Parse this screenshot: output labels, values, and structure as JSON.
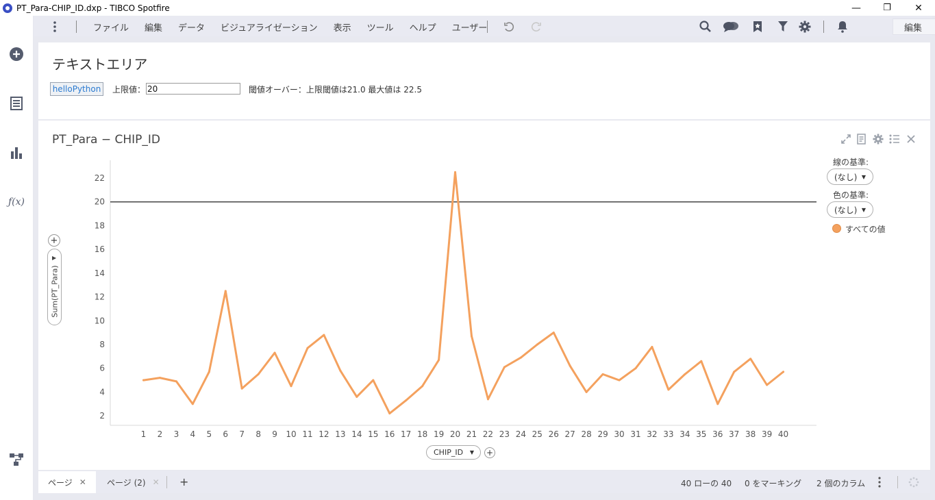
{
  "window": {
    "title": "PT_Para-CHIP_ID.dxp - TIBCO Spotfire",
    "minimize": "—",
    "restore": "❐",
    "close": "✕"
  },
  "menu": {
    "items": [
      "ファイル",
      "編集",
      "データ",
      "ビジュアライゼーション",
      "表示",
      "ツール",
      "ヘルプ",
      "ユーザー"
    ],
    "mode_select": "編集"
  },
  "text_area": {
    "title": "テキストエリア",
    "button_label": "helloPython",
    "upper_label": "上限値：",
    "upper_value": "20",
    "message": "閾値オーバー：上限閾値は21.0 最大値は 22.5"
  },
  "chart_panel": {
    "title": "PT_Para − CHIP_ID",
    "y_axis_selector": "Sum(PT_Para)",
    "x_axis_selector": "CHIP_ID",
    "legend": {
      "line_by_label": "線の基準:",
      "line_by_value": "(なし)",
      "color_by_label": "色の基準:",
      "color_by_value": "(なし)",
      "entry": "すべての値",
      "entry_color": "#f4a15e"
    }
  },
  "chart_data": {
    "type": "line",
    "x": [
      1,
      2,
      3,
      4,
      5,
      6,
      7,
      8,
      9,
      10,
      11,
      12,
      13,
      14,
      15,
      16,
      17,
      18,
      19,
      20,
      21,
      22,
      23,
      24,
      25,
      26,
      27,
      28,
      29,
      30,
      31,
      32,
      33,
      34,
      35,
      36,
      37,
      38,
      39,
      40
    ],
    "series": [
      {
        "values": [
          5.0,
          5.2,
          4.9,
          3.0,
          5.7,
          12.5,
          4.3,
          5.5,
          7.3,
          4.5,
          7.7,
          8.8,
          5.8,
          3.6,
          5.0,
          2.2,
          3.3,
          4.5,
          6.7,
          22.5,
          8.7,
          3.4,
          6.1,
          6.9,
          8.0,
          9.0,
          6.2,
          4.0,
          5.5,
          5.0,
          6.0,
          7.8,
          4.2,
          5.5,
          6.6,
          3.0,
          5.7,
          6.8,
          4.6,
          5.7
        ],
        "color": "#f4a15e"
      }
    ],
    "reference_line": 20,
    "y_ticks": [
      2,
      4,
      6,
      8,
      10,
      12,
      14,
      16,
      18,
      20,
      22
    ],
    "ylim": [
      1.2,
      23.5
    ],
    "xlabel": "CHIP_ID",
    "ylabel": "Sum(PT_Para)"
  },
  "status": {
    "tabs": [
      "ページ",
      "ページ (2)"
    ],
    "add_tab": "+",
    "rows": "40 ローの 40",
    "marking": "0 をマーキング",
    "columns": "2 個のカラム"
  }
}
